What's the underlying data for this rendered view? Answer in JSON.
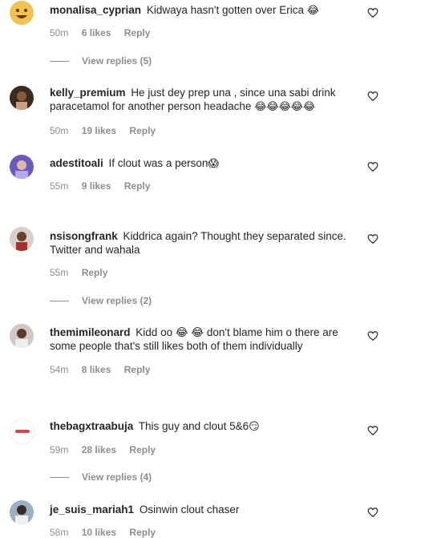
{
  "comments": [
    {
      "username": "monalisa_cyprian",
      "text": "Kidwaya hasn't gotten over Erica",
      "emoji": "😂",
      "time": "50m",
      "likes": "6 likes",
      "reply": "Reply"
    },
    {
      "username": "kelly_premium",
      "text": "He just dey prep una , since una sabi drink paracetamol for another person headache",
      "emoji": "😂😂😂😂😂",
      "time": "50m",
      "likes": "19 likes",
      "reply": "Reply"
    },
    {
      "username": "adestitoali",
      "text": "If clout was a person",
      "emoji": "😱",
      "time": "55m",
      "likes": "9 likes",
      "reply": "Reply"
    },
    {
      "username": "nsisongfrank",
      "text": "Kiddrica again? Thought they separated since. Twitter and wahala",
      "emoji": "",
      "time": "55m",
      "likes": "",
      "reply": "Reply"
    },
    {
      "username": "themimileonard",
      "text": "Kidd oo 😂 😂 don't blame him o there are some people that's still likes both of them individually",
      "emoji": "",
      "time": "54m",
      "likes": "8 likes",
      "reply": "Reply"
    },
    {
      "username": "thebagxtraabuja",
      "text": "This guy and clout 5&6",
      "emoji": "😏",
      "time": "59m",
      "likes": "28 likes",
      "reply": "Reply"
    },
    {
      "username": "je_suis_mariah1",
      "text": "Osinwin clout chaser",
      "emoji": "",
      "time": "58m",
      "likes": "10 likes",
      "reply": "Reply"
    }
  ],
  "view_replies": [
    "View replies (5)",
    "View replies (2)",
    "View replies (4)"
  ],
  "colors": {
    "text": "#262626",
    "muted": "#8e8e8e",
    "background": "#ffffff"
  },
  "icons": {
    "like": "heart-outline-icon"
  }
}
